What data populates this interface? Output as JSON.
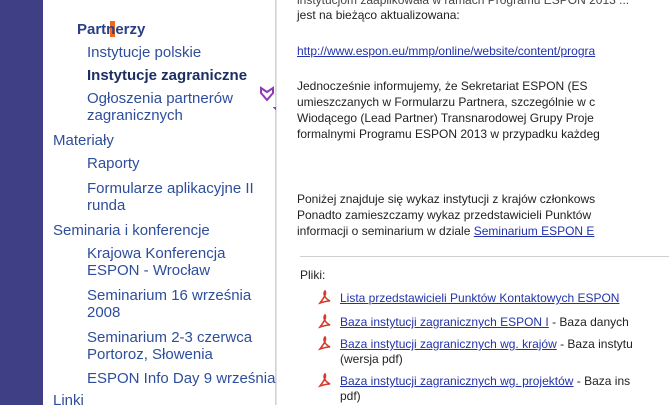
{
  "sidebar": {
    "partnerzy": "Partnerzy",
    "instytucje_polskie": "Instytucje polskie",
    "instytucje_zagraniczne": "Instytucje zagraniczne",
    "ogloszenia_1": "Ogłoszenia partnerów",
    "ogloszenia_2": "zagranicznych",
    "materialy": "Materiały",
    "raporty": "Raporty",
    "formularze_1": "Formularze aplikacyjne II",
    "formularze_2": "runda",
    "seminaria": "Seminaria i konferencje",
    "krajowa_1": "Krajowa Konferencja",
    "krajowa_2": "ESPON - Wrocław",
    "sem16_1": "Seminarium 16 września",
    "sem16_2": "2008",
    "sem23_1": "Seminarium 2-3 czerwca",
    "sem23_2": "Portoroz, Słowenia",
    "infoday": "ESPON Info Day 9 września",
    "linki": "Linki"
  },
  "main": {
    "line0": "instytucjom zaaplikowała w ramach Programu ESPON 2013 ...",
    "line1": "jest na bieżąco aktualizowana:",
    "url": "http://www.espon.eu/mmp/online/website/content/progra",
    "para1": [
      "Jednocześnie informujemy, że Sekretariat ESPON (ES",
      "umieszczanych w Formularzu Partnera, szczególnie w c",
      "Wiodącego (Lead Partner) Transnarodowej Grupy Proje",
      "formalnymi Programu ESPON 2013 w przypadku każdeg"
    ],
    "para2": [
      "Poniżej znajduje się wykaz instytucji z krajów członkows",
      "Ponadto zamieszczamy wykaz przedstawicieli Punktów"
    ],
    "para2_last_prefix": "informacji o seminarium w dziale ",
    "para2_last_link": "Seminarium ESPON E",
    "pliki_label": "Pliki:",
    "files": [
      {
        "link": "Lista przedstawicieli Punktów Kontaktowych ESPON",
        "desc": ""
      },
      {
        "link": "Baza instytucji zagranicznych ESPON I",
        "desc": " - Baza danych"
      },
      {
        "link": "Baza instytucji zagranicznych wg. krajów",
        "desc": " - Baza instytu",
        "desc2": "(wersja pdf)"
      },
      {
        "link": "Baza instytucji zagranicznych wg. projektów",
        "desc": " - Baza ins",
        "desc2": "pdf)"
      }
    ]
  },
  "colors": {
    "leftbar": "#3f3f86",
    "marker": "#f06a1e",
    "arrow": "#8e3ab4",
    "link": "#2233aa",
    "pdf": "#d63a2a"
  },
  "icons": [
    "arrow-down-icon",
    "pdf-icon"
  ]
}
